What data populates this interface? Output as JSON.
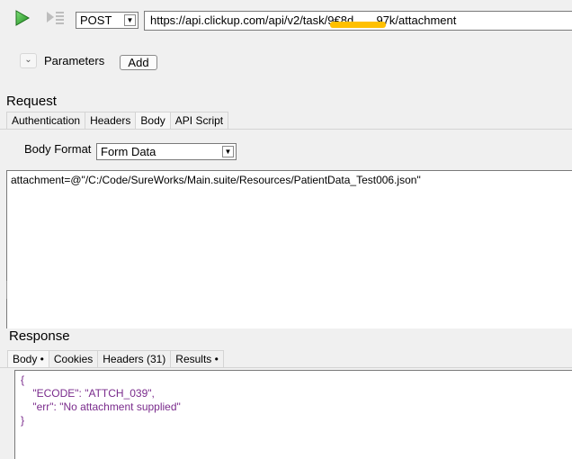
{
  "toolbar": {
    "method": "POST",
    "url": "https://api.clickup.com/v2/task/968d   97k/attachment",
    "url_display": "https://api.clickup.com/api/v2/task/9€8d    97k/attachment",
    "redaction_color": "#ffc000"
  },
  "parameters": {
    "label": "Parameters",
    "add_label": "Add"
  },
  "request": {
    "title": "Request",
    "tabs": [
      "Authentication",
      "Headers",
      "Body",
      "API Script"
    ],
    "active_tab": "Body",
    "body_format_label": "Body Format",
    "body_format_value": "Form Data",
    "body_text": "attachment=@\"/C:/Code/SureWorks/Main.suite/Resources/PatientData_Test006.json\""
  },
  "response": {
    "title": "Response",
    "tabs": [
      "Body •",
      "Cookies",
      "Headers (31)",
      "Results •"
    ],
    "active_tab": "Body •",
    "json_lines": [
      "{",
      "    \"ECODE\": \"ATTCH_039\",",
      "    \"err\": \"No attachment supplied\"",
      "}"
    ],
    "json_color": "#7a2b8c"
  },
  "icons": {
    "run": "play-icon",
    "step": "step-run-icon"
  }
}
